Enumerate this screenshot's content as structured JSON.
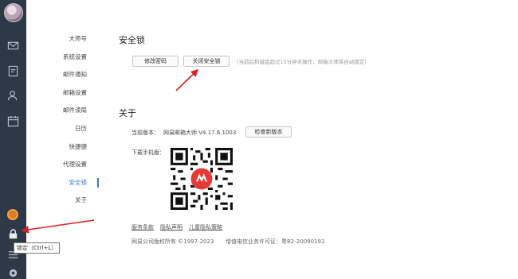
{
  "sidebar_tooltip": "锁定（Ctrl+L）",
  "settings_nav": {
    "items": [
      {
        "label": "大师号"
      },
      {
        "label": "系统设置"
      },
      {
        "label": "邮件通知"
      },
      {
        "label": "邮箱设置"
      },
      {
        "label": "邮件读局"
      },
      {
        "label": "日历"
      },
      {
        "label": "快捷键"
      },
      {
        "label": "代理设置"
      },
      {
        "label": "安全锁",
        "active": true
      },
      {
        "label": "关于"
      }
    ]
  },
  "security_lock": {
    "title": "安全锁",
    "change_password_label": "修改密码",
    "close_lock_label": "关闭安全锁",
    "hint": "（当前后和键盘超过15分钟未操作，邮箱大师将自动锁定）"
  },
  "about": {
    "title": "关于",
    "version_label": "当前版本：",
    "version_value": "网易邮箱大师 V4.17.6.1003",
    "check_update_label": "检查新版本",
    "download_label": "下载手机版：",
    "links": [
      "服务条款",
      "隐私声明",
      "儿童隐私策略"
    ],
    "copyright": "网易公司版权所有 ©1997-2023",
    "license": "增值电信业务许可证：粤B2-20090191"
  },
  "colors": {
    "sidebar": "#2e3947",
    "accent": "#3a7bd5",
    "arrow": "#d32222"
  }
}
